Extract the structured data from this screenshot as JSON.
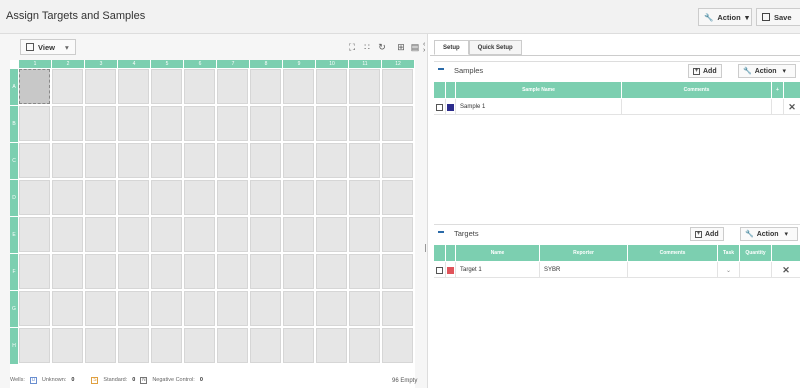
{
  "window": {
    "title": "Assign Targets and Samples"
  },
  "toolbar": {
    "action_label": "Action",
    "save_label": "Save"
  },
  "plate": {
    "view_label": "View",
    "columns": [
      "1",
      "2",
      "3",
      "4",
      "5",
      "6",
      "7",
      "8",
      "9",
      "10",
      "11",
      "12"
    ],
    "rows": [
      "A",
      "B",
      "C",
      "D",
      "E",
      "F",
      "G",
      "H"
    ],
    "selected_well": "A1"
  },
  "legend": {
    "prefix": "Wells:",
    "unknown_label": "Unknown:",
    "unknown_count": "0",
    "standard_label": "Standard:",
    "standard_count": "0",
    "negative_label": "Negative Control:",
    "negative_count": "0",
    "empty_text": "96 Empty"
  },
  "tabs": [
    {
      "label": "Setup",
      "active": true
    },
    {
      "label": "Quick Setup",
      "active": false
    }
  ],
  "samples": {
    "title": "Samples",
    "add_label": "Add",
    "action_label": "Action",
    "columns": [
      "Sample Name",
      "Comments",
      "+"
    ],
    "rows": [
      {
        "name": "Sample 1",
        "color": "#2c2c8c",
        "comments": ""
      }
    ]
  },
  "targets": {
    "title": "Targets",
    "add_label": "Add",
    "action_label": "Action",
    "columns": [
      "Name",
      "Reporter",
      "Comments",
      "Task",
      "Quantity"
    ],
    "rows": [
      {
        "name": "Target 1",
        "color": "#e0535a",
        "reporter": "SYBR",
        "comments": "",
        "task": "",
        "quantity": ""
      }
    ]
  },
  "colors": {
    "accent_teal": "#7ccfb0",
    "minus_blue": "#2b6aa8"
  }
}
